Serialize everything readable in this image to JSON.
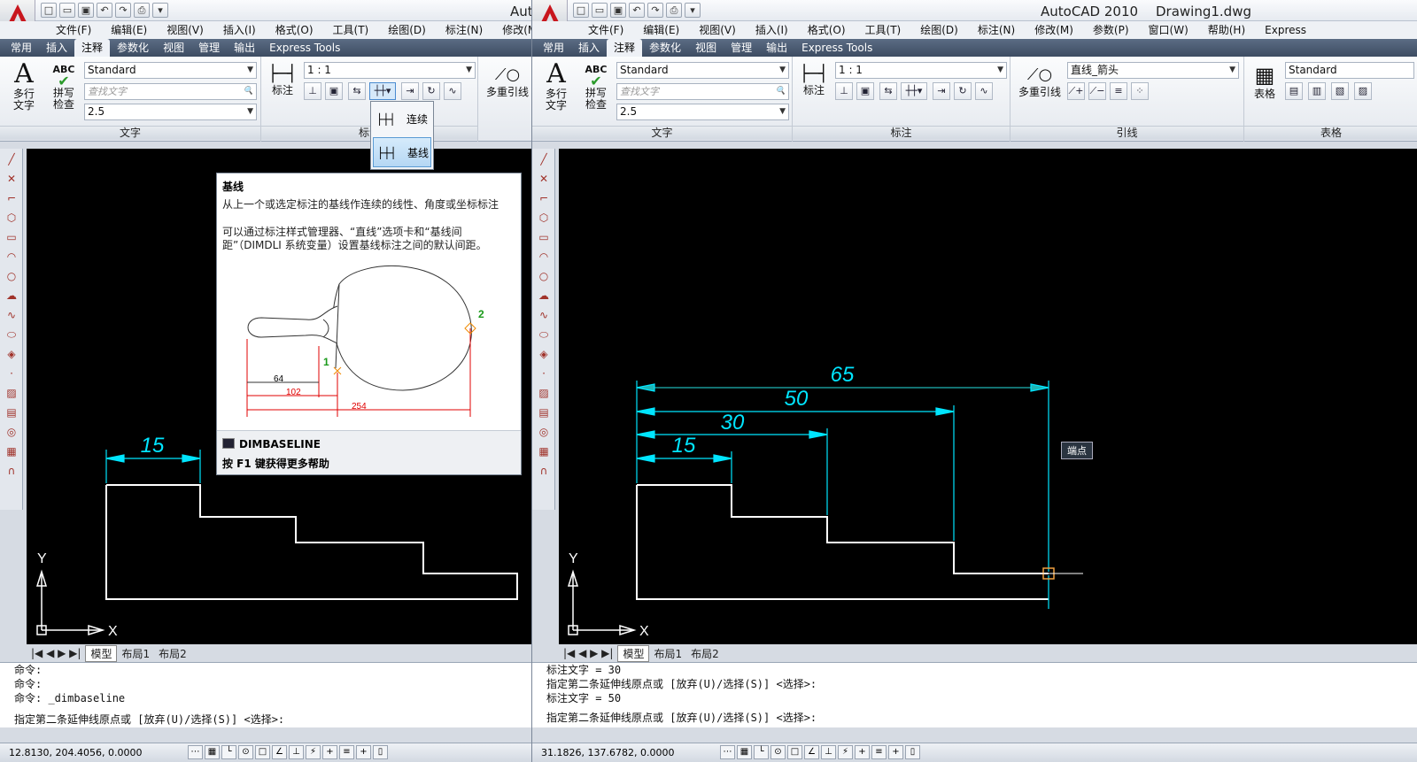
{
  "left": {
    "app_title": "Aut",
    "menus": [
      "文件(F)",
      "编辑(E)",
      "视图(V)",
      "插入(I)",
      "格式(O)",
      "工具(T)",
      "绘图(D)",
      "标注(N)",
      "修改(M)"
    ],
    "tabs": [
      "常用",
      "插入",
      "注释",
      "参数化",
      "视图",
      "管理",
      "输出",
      "Express Tools"
    ],
    "active_tab": "注释",
    "text_group": {
      "label": "文字",
      "mtext": "多行\n文字",
      "spell": "拼写\n检查",
      "style": "Standard",
      "find_placeholder": "查找文字",
      "height": "2.5"
    },
    "dim_group": {
      "label": "标注",
      "dim": "标注",
      "scale": "1 : 1"
    },
    "leader_group": {
      "multileader": "多重引线"
    },
    "dropdown": {
      "continue_label": "连续",
      "baseline_label": "基线"
    },
    "tooltip": {
      "title": "基线",
      "subtitle": "从上一个或选定标注的基线作连续的线性、角度或坐标标注",
      "body": "可以通过标注样式管理器、“直线”选项卡和“基线间距”（DIMDLI 系统变量）设置基线标注之间的默认间距。",
      "point1": "1",
      "point2": "2",
      "dim64": "64",
      "dim102": "102",
      "dim254": "254",
      "command": "DIMBASELINE",
      "help": "按 F1 键获得更多帮助"
    },
    "canvas": {
      "dim15": "15",
      "axis_x": "X",
      "axis_y": "Y"
    },
    "layout_tabs": [
      "模型",
      "布局1",
      "布局2"
    ],
    "command_lines": [
      "命令:",
      "命令:",
      "命令: _dimbaseline"
    ],
    "command_prompt": "指定第二条延伸线原点或 [放弃(U)/选择(S)] <选择>:",
    "coords": "12.8130,  204.4056, 0.0000"
  },
  "right": {
    "app_title": "AutoCAD 2010",
    "doc_title": "Drawing1.dwg",
    "menus": [
      "文件(F)",
      "编辑(E)",
      "视图(V)",
      "插入(I)",
      "格式(O)",
      "工具(T)",
      "绘图(D)",
      "标注(N)",
      "修改(M)",
      "参数(P)",
      "窗口(W)",
      "帮助(H)",
      "Express"
    ],
    "tabs": [
      "常用",
      "插入",
      "注释",
      "参数化",
      "视图",
      "管理",
      "输出",
      "Express Tools"
    ],
    "active_tab": "注释",
    "text_group": {
      "label": "文字",
      "mtext": "多行\n文字",
      "spell": "拼写\n检查",
      "style": "Standard",
      "find_placeholder": "查找文字",
      "height": "2.5"
    },
    "dim_group": {
      "label": "标注",
      "dim": "标注",
      "scale": "1 : 1"
    },
    "leader_group": {
      "label": "引线",
      "multileader": "多重引线",
      "style": "直线_箭头"
    },
    "table_group": {
      "label": "表格",
      "table": "表格",
      "style": "Standard"
    },
    "canvas": {
      "dim15": "15",
      "dim30": "30",
      "dim50": "50",
      "dim65": "65",
      "axis_x": "X",
      "axis_y": "Y"
    },
    "snap_tip": "端点",
    "layout_tabs": [
      "模型",
      "布局1",
      "布局2"
    ],
    "command_lines": [
      "标注文字 = 30",
      "指定第二条延伸线原点或 [放弃(U)/选择(S)] <选择>:",
      "标注文字 = 50"
    ],
    "command_prompt": "指定第二条延伸线原点或 [放弃(U)/选择(S)] <选择>:",
    "coords": "31.1826,  137.6782, 0.0000"
  },
  "colors": {
    "canvas": "#000000",
    "dimension": "#00e5ff",
    "geometry": "#ffffff",
    "ribbon_tab": "#3d4c62",
    "red_dim": "#e00000"
  }
}
